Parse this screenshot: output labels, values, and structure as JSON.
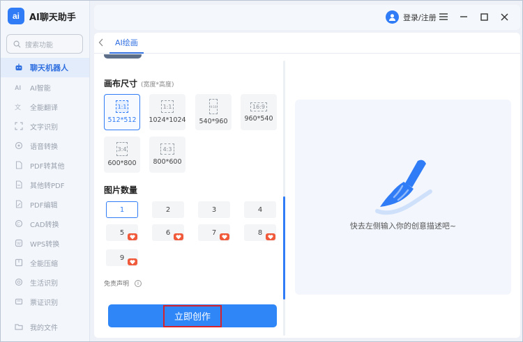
{
  "app": {
    "logo_text": "ai",
    "title": "AI聊天助手"
  },
  "sidebar": {
    "search_placeholder": "搜索功能",
    "items": [
      {
        "label": "聊天机器人",
        "icon": "robot-icon",
        "active": true
      },
      {
        "label": "AI智能",
        "icon": "ai-icon",
        "active": false
      },
      {
        "label": "全能翻译",
        "icon": "translate-icon",
        "active": false
      },
      {
        "label": "文字识别",
        "icon": "text-scan-icon",
        "active": false
      },
      {
        "label": "语音转换",
        "icon": "voice-icon",
        "active": false
      },
      {
        "label": "PDF转其他",
        "icon": "pdf-icon",
        "active": false
      },
      {
        "label": "其他转PDF",
        "icon": "file-convert-icon",
        "active": false
      },
      {
        "label": "PDF编辑",
        "icon": "pdf-edit-icon",
        "active": false
      },
      {
        "label": "CAD转换",
        "icon": "cad-icon",
        "active": false
      },
      {
        "label": "WPS转换",
        "icon": "wps-icon",
        "active": false
      },
      {
        "label": "全能压缩",
        "icon": "compress-icon",
        "active": false
      },
      {
        "label": "生活识别",
        "icon": "life-scan-icon",
        "active": false
      },
      {
        "label": "票证识别",
        "icon": "ticket-icon",
        "active": false
      }
    ],
    "files_label": "我的文件"
  },
  "header": {
    "login_label": "登录/注册"
  },
  "tabs": {
    "active": "AI绘画"
  },
  "canvas": {
    "title": "画布尺寸",
    "subtitle": "(宽度*高度)",
    "ratios": [
      {
        "ratio": "1:1",
        "size": "512*512",
        "selected": true
      },
      {
        "ratio": "1:1",
        "size": "1024*1024",
        "selected": false
      },
      {
        "ratio": "9:16",
        "size": "540*960",
        "selected": false
      },
      {
        "ratio": "16:9",
        "size": "960*540",
        "selected": false
      },
      {
        "ratio": "3:4",
        "size": "600*800",
        "selected": false
      },
      {
        "ratio": "4:3",
        "size": "800*600",
        "selected": false
      }
    ]
  },
  "count": {
    "title": "图片数量",
    "options": [
      {
        "value": "1",
        "selected": true,
        "vip": false
      },
      {
        "value": "2",
        "selected": false,
        "vip": false
      },
      {
        "value": "3",
        "selected": false,
        "vip": false
      },
      {
        "value": "4",
        "selected": false,
        "vip": false
      },
      {
        "value": "5",
        "selected": false,
        "vip": true
      },
      {
        "value": "6",
        "selected": false,
        "vip": true
      },
      {
        "value": "7",
        "selected": false,
        "vip": true
      },
      {
        "value": "8",
        "selected": false,
        "vip": true
      },
      {
        "value": "9",
        "selected": false,
        "vip": true
      }
    ]
  },
  "disclaimer": "免责声明",
  "create_button": "立即创作",
  "preview": {
    "hint": "快去左侧输入你的创意描述吧~"
  },
  "colors": {
    "accent": "#2f7cf6",
    "vip": "#f05a3a",
    "highlight_border": "#d6232b"
  }
}
